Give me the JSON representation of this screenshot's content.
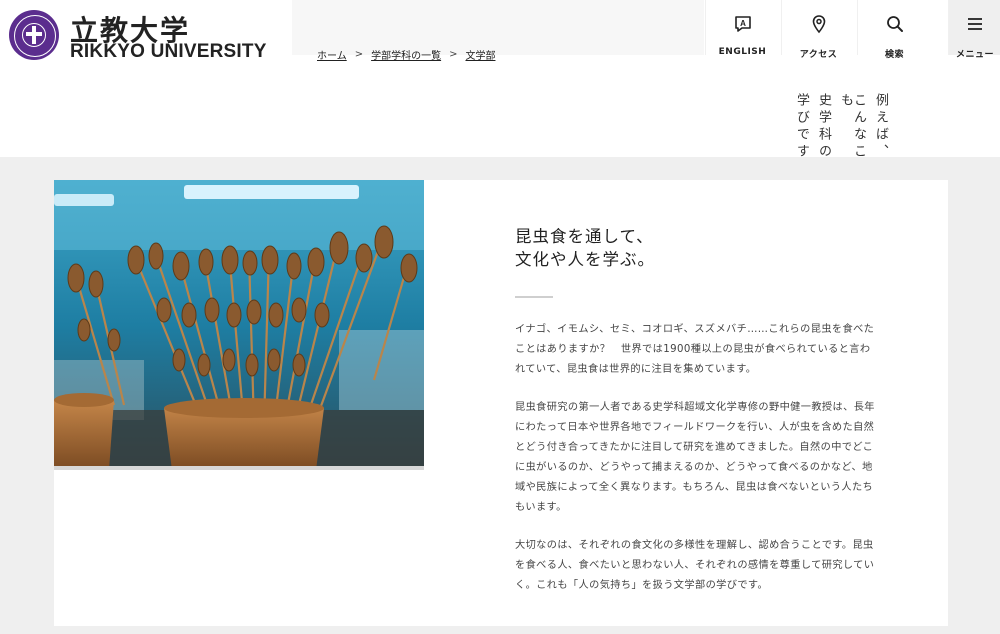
{
  "header": {
    "logo_jp": "立教大学",
    "logo_en": "RIKKYO UNIVERSITY",
    "breadcrumb": [
      "ホーム",
      "学部学科の一覧",
      "文学部"
    ],
    "nav": {
      "english": "ENGLISH",
      "access": "アクセス",
      "search": "検索",
      "menu": "メニュー"
    },
    "vertical_lines": [
      "例えば、",
      "こんなことも",
      "史学科の",
      "学びです。"
    ]
  },
  "main": {
    "image_icon": "skewered-insects-photo",
    "heading_lines": [
      "昆虫食を通して、",
      "文化や人を学ぶ。"
    ],
    "paragraphs": [
      "イナゴ、イモムシ、セミ、コオロギ、スズメバチ……これらの昆虫を食べたことはありますか？　世界では1900種以上の昆虫が食べられていると言われていて、昆虫食は世界的に注目を集めています。",
      "昆虫食研究の第一人者である史学科超域文化学専修の野中健一教授は、長年にわたって日本や世界各地でフィールドワークを行い、人が虫を含めた自然とどう付き合ってきたかに注目して研究を進めてきました。自然の中でどこに虫がいるのか、どうやって捕まえるのか、どうやって食べるのかなど、地域や民族によって全く異なります。もちろん、昆虫は食べないという人たちもいます。",
      "大切なのは、それぞれの食文化の多様性を理解し、認め合うことです。昆虫を食べる人、食べたいと思わない人、それぞれの感情を尊重して研究していく。これも「人の気持ち」を扱う文学部の学びです。"
    ]
  },
  "colors": {
    "brand_purple": "#5b2d8e",
    "background_gray": "#efefef"
  }
}
